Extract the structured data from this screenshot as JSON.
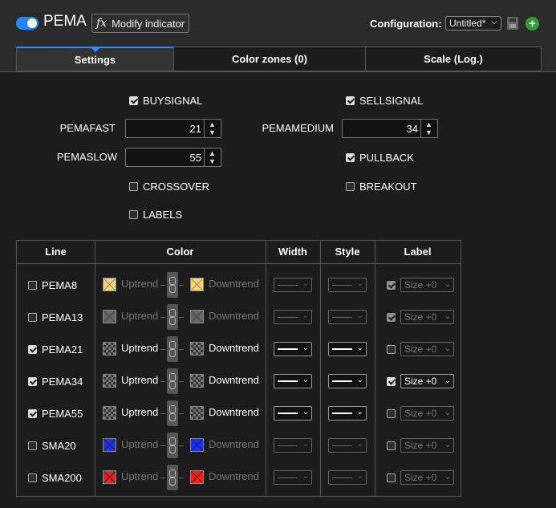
{
  "header": {
    "title": "PEMA",
    "modify_label": "Modify indicator",
    "fx_glyph": "fx",
    "config_label": "Configuration:",
    "config_value": "Untitled*",
    "add_glyph": "+",
    "toggle_on": true
  },
  "tabs": [
    {
      "label": "Settings",
      "active": true
    },
    {
      "label": "Color zones (0)",
      "active": false
    },
    {
      "label": "Scale (Log.)",
      "active": false
    }
  ],
  "settings": {
    "buysignal": {
      "label": "BUYSIGNAL",
      "checked": true
    },
    "sellsignal": {
      "label": "SELLSIGNAL",
      "checked": true
    },
    "pemafast": {
      "label": "PEMAFAST",
      "value": "21"
    },
    "pemamedium": {
      "label": "PEMAMEDIUM",
      "value": "34"
    },
    "pemaslow": {
      "label": "PEMASLOW",
      "value": "55"
    },
    "pullback": {
      "label": "PULLBACK",
      "checked": true
    },
    "crossover": {
      "label": "CROSSOVER",
      "checked": false
    },
    "breakout": {
      "label": "BREAKOUT",
      "checked": false
    },
    "labels": {
      "label": "LABELS",
      "checked": false
    }
  },
  "table": {
    "headers": {
      "line": "Line",
      "color": "Color",
      "width": "Width",
      "style": "Style",
      "label": "Label"
    },
    "uptrend": "Uptrend",
    "downtrend": "Downtrend",
    "rows": [
      {
        "name": "PEMA8",
        "checked": false,
        "color": "#f5d77a",
        "pattern": "x",
        "label_checked": true,
        "size": "Size +0",
        "active": false
      },
      {
        "name": "PEMA13",
        "checked": false,
        "color": "#666666",
        "pattern": "x",
        "label_checked": true,
        "size": "Size +0",
        "active": false
      },
      {
        "name": "PEMA21",
        "checked": true,
        "color": "#888888",
        "pattern": "checker",
        "label_checked": false,
        "size": "Size +0",
        "active": true
      },
      {
        "name": "PEMA34",
        "checked": true,
        "color": "#888888",
        "pattern": "checker",
        "label_checked": true,
        "size": "Size +0",
        "active": true
      },
      {
        "name": "PEMA55",
        "checked": true,
        "color": "#888888",
        "pattern": "checker",
        "label_checked": false,
        "size": "Size +0",
        "active": true
      },
      {
        "name": "SMA20",
        "checked": false,
        "color": "#1a2fff",
        "pattern": "x",
        "label_checked": false,
        "size": "Size +0",
        "active": false
      },
      {
        "name": "SMA200",
        "checked": false,
        "color": "#ff1a1a",
        "pattern": "x",
        "label_checked": false,
        "size": "Size +0",
        "active": false
      }
    ]
  },
  "colors": {
    "accent": "#1e88ff",
    "add": "#2ca02c"
  }
}
